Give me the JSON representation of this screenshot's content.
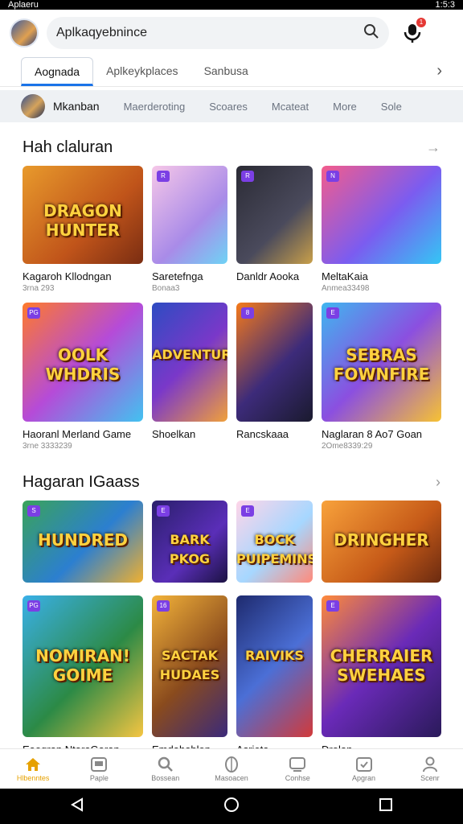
{
  "status": {
    "left": "Aplaeru",
    "right": "1:5:3"
  },
  "search": {
    "text": "Aplkaqyebnince"
  },
  "notification_count": "1",
  "tabs": [
    {
      "label": "Aognada"
    },
    {
      "label": "Aplkeykplaces"
    },
    {
      "label": "Sanbusa"
    }
  ],
  "subnav": [
    "Mkanban",
    "Maerderoting",
    "Scoares",
    "Mcateat",
    "More",
    "Sole"
  ],
  "sections": [
    {
      "title": "Hah claluran"
    },
    {
      "title": "Hagaran IGaass"
    }
  ],
  "cards": [
    {
      "title": "Kagaroh Kllodngan",
      "sub": "3rna 293",
      "badge": ""
    },
    {
      "title": "Sarete⁠fnga",
      "sub": "Bonaa3",
      "badge": "R"
    },
    {
      "title": "Danldr Aooka",
      "sub": "",
      "badge": "R"
    },
    {
      "title": "MeltaKaia",
      "sub": "Anmea33498",
      "badge": "N"
    },
    {
      "title": "Haoranl Merland Game",
      "sub": "3rne 3333239",
      "badge": "PG"
    },
    {
      "title": "Shoelkan",
      "sub": "",
      "badge": ""
    },
    {
      "title": "Rancskaaa",
      "sub": "",
      "badge": "8"
    },
    {
      "title": "Naglaran 8 Ao7 Goan",
      "sub": "2Ome8339:29",
      "badge": "E"
    },
    {
      "title": "",
      "sub": "",
      "badge": "S"
    },
    {
      "title": "",
      "sub": "",
      "badge": "E"
    },
    {
      "title": "",
      "sub": "",
      "badge": "E"
    },
    {
      "title": "",
      "sub": "",
      "badge": ""
    },
    {
      "title": "Eaogran NtaraGaran",
      "sub": "",
      "badge": "PG"
    },
    {
      "title": "Emdahablon",
      "sub": "",
      "badge": "16"
    },
    {
      "title": "Asrjeta",
      "sub": "",
      "badge": ""
    },
    {
      "title": "Drolan",
      "sub": "",
      "badge": "E"
    }
  ],
  "card_art_text": [
    "DRAGON\nHUNTER",
    "",
    "",
    "",
    "OOLK\nWHDRIS",
    "ADVENTURE",
    "",
    "SEBRAS\nFOWNFIRE",
    "HUNDRED",
    "BARK\nPKOG",
    "BOCK\nPUIPEMINS",
    "DRINGHER",
    "NOMIRAN!\nGOIME",
    "SACTAK\nHUDAES",
    "RAIVIKS",
    "CHERRAIER\nSWEHAES"
  ],
  "bottom_nav": [
    {
      "label": "Hlbenntes",
      "icon": "home-icon"
    },
    {
      "label": "Paple",
      "icon": "apps-icon"
    },
    {
      "label": "Bossean",
      "icon": "search-icon"
    },
    {
      "label": "Masoacen",
      "icon": "leaf-icon"
    },
    {
      "label": "Conhse",
      "icon": "tv-icon"
    },
    {
      "label": "Apgran",
      "icon": "chat-icon"
    },
    {
      "label": "Scenr",
      "icon": "person-icon"
    }
  ],
  "colors": {
    "accent": "#1a73e8",
    "active_nav": "#e6a100",
    "badge": "#7b3fe4",
    "notif": "#e53935"
  }
}
